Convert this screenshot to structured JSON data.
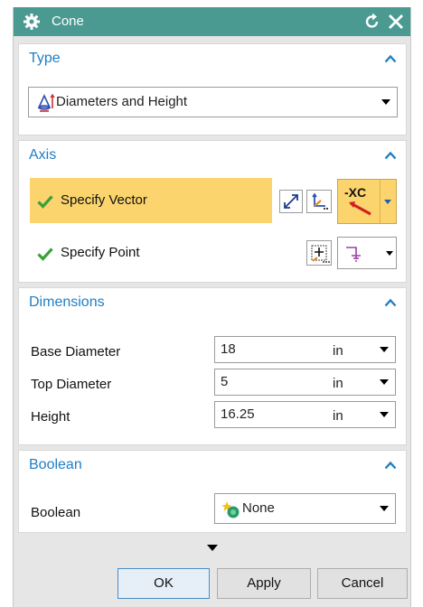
{
  "window": {
    "title": "Cone",
    "icons": {
      "app": "gear-icon",
      "reset": "reset-icon",
      "close": "close-icon"
    }
  },
  "type_group": {
    "title": "Type",
    "selected": "Diameters and Height",
    "icon": "cone-type-icon"
  },
  "axis_group": {
    "title": "Axis",
    "specify_vector": "Specify Vector",
    "specify_point": "Specify Point",
    "vector_option": "-XC",
    "highlight_color": "#fbd46e"
  },
  "dimensions_group": {
    "title": "Dimensions",
    "rows": [
      {
        "label": "Base Diameter",
        "value": "18",
        "unit": "in"
      },
      {
        "label": "Top Diameter",
        "value": "5",
        "unit": "in"
      },
      {
        "label": "Height",
        "value": "16.25",
        "unit": "in"
      }
    ]
  },
  "boolean_group": {
    "title": "Boolean",
    "label": "Boolean",
    "selected": "None"
  },
  "buttons": {
    "ok": "OK",
    "apply": "Apply",
    "cancel": "Cancel"
  },
  "colors": {
    "titlebar": "#4a9a92",
    "group_title": "#1f7ec4",
    "check": "#3aa13a"
  }
}
